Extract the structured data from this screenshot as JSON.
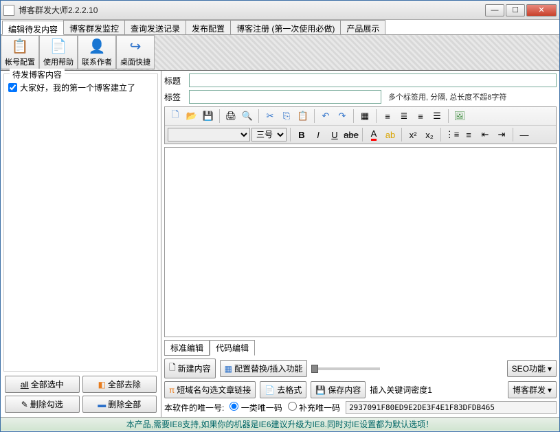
{
  "window": {
    "title": "博客群发大师2.2.2.10"
  },
  "tabs": [
    "编辑待发内容",
    "博客群发监控",
    "查询发送记录",
    "发布配置",
    "博客注册 (第一次使用必做)",
    "产品展示"
  ],
  "toolbar": [
    {
      "icon": "📋",
      "label": "帐号配置"
    },
    {
      "icon": "📄",
      "label": "使用帮助"
    },
    {
      "icon": "👤",
      "label": "联系作者"
    },
    {
      "icon": "↩",
      "label": "桌面快捷"
    }
  ],
  "left": {
    "group_title": "待发博客内容",
    "items": [
      {
        "checked": true,
        "text": "大家好，我的第一个博客建立了"
      }
    ],
    "buttons": {
      "select_all": "全部选中",
      "remove_all": "全部去除",
      "del_checked": "删除勾选",
      "del_all": "删除全部"
    }
  },
  "form": {
    "title_label": "标题",
    "title_value": "",
    "tag_label": "标签",
    "tag_value": "",
    "tag_hint": "多个标签用, 分隔, 总长度不超8字符"
  },
  "editor": {
    "font_size_label": "三号",
    "tabs": [
      "标准编辑",
      "代码编辑"
    ]
  },
  "actions": {
    "new": "新建内容",
    "config": "配置替换/插入功能",
    "seo": "SEO功能",
    "shortlink": "短域名勾选文章链接",
    "strip": "去格式",
    "save": "保存内容",
    "keyword_label": "插入关键词密度1",
    "publish": "博客群发"
  },
  "serial": {
    "label": "本软件的唯一号:",
    "opt1": "一类唯一码",
    "opt2": "补充唯一码",
    "value": "2937091F80ED9E2DE3F4E1F83DFDB465"
  },
  "footer": "本产品,需要IE8支持,如果你的机器是IE6建议升级为IE8.同时对IE设置都为默认选项！"
}
